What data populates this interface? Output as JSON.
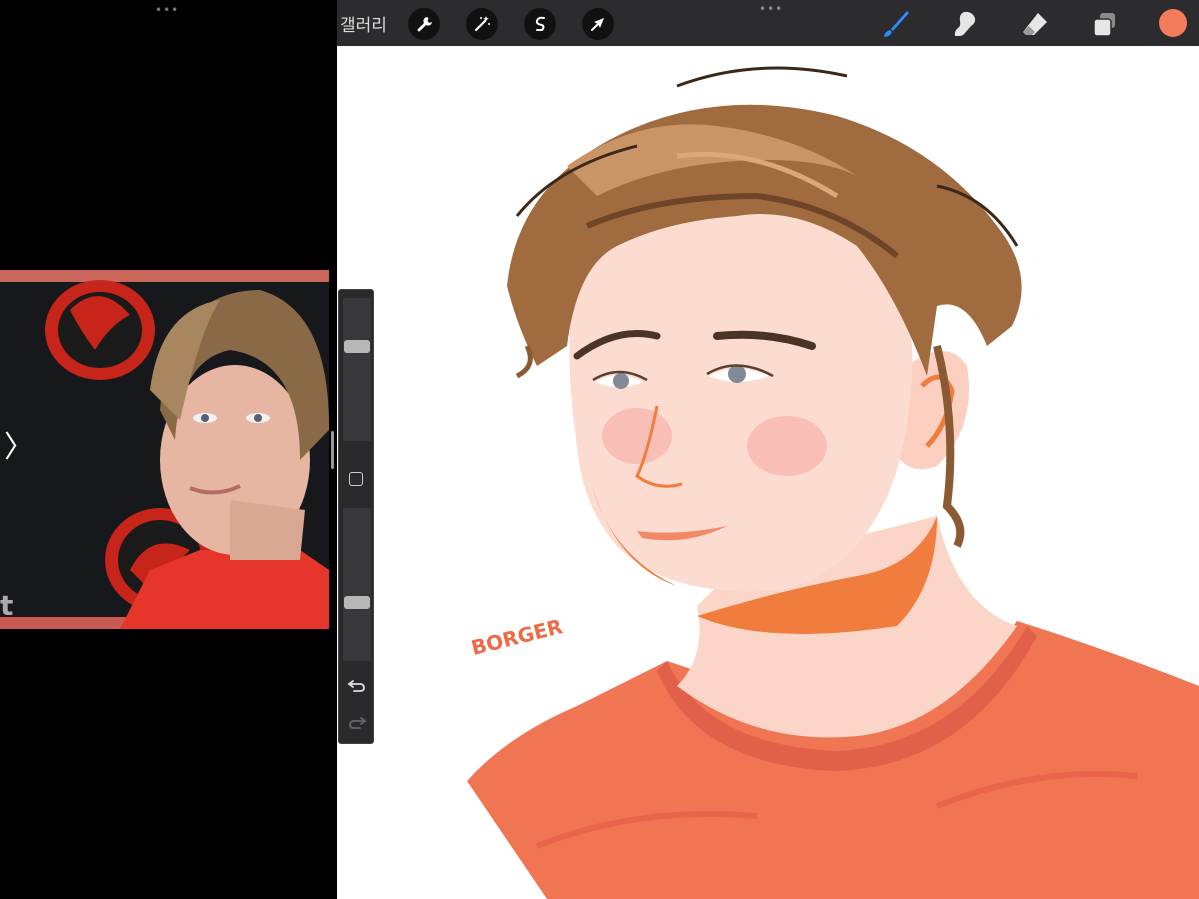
{
  "app": {
    "left_pane": {
      "grabber": "•••"
    },
    "toolbar": {
      "gallery_label": "갤러리",
      "actions": [
        "wrench-icon",
        "magic-wand-icon",
        "selection-icon",
        "transform-arrow-icon"
      ],
      "tools": [
        "brush-icon",
        "smudge-icon",
        "eraser-icon",
        "layers-icon"
      ],
      "grabber": "•••",
      "current_color": "#f47c5a",
      "active_tool_color": "#2f8cf6"
    },
    "sidebar": {
      "brush_size": 0.68,
      "brush_opacity": 0.37
    },
    "reference": {
      "nav_label": "〉"
    },
    "canvas": {
      "signature": "BORGER"
    }
  }
}
